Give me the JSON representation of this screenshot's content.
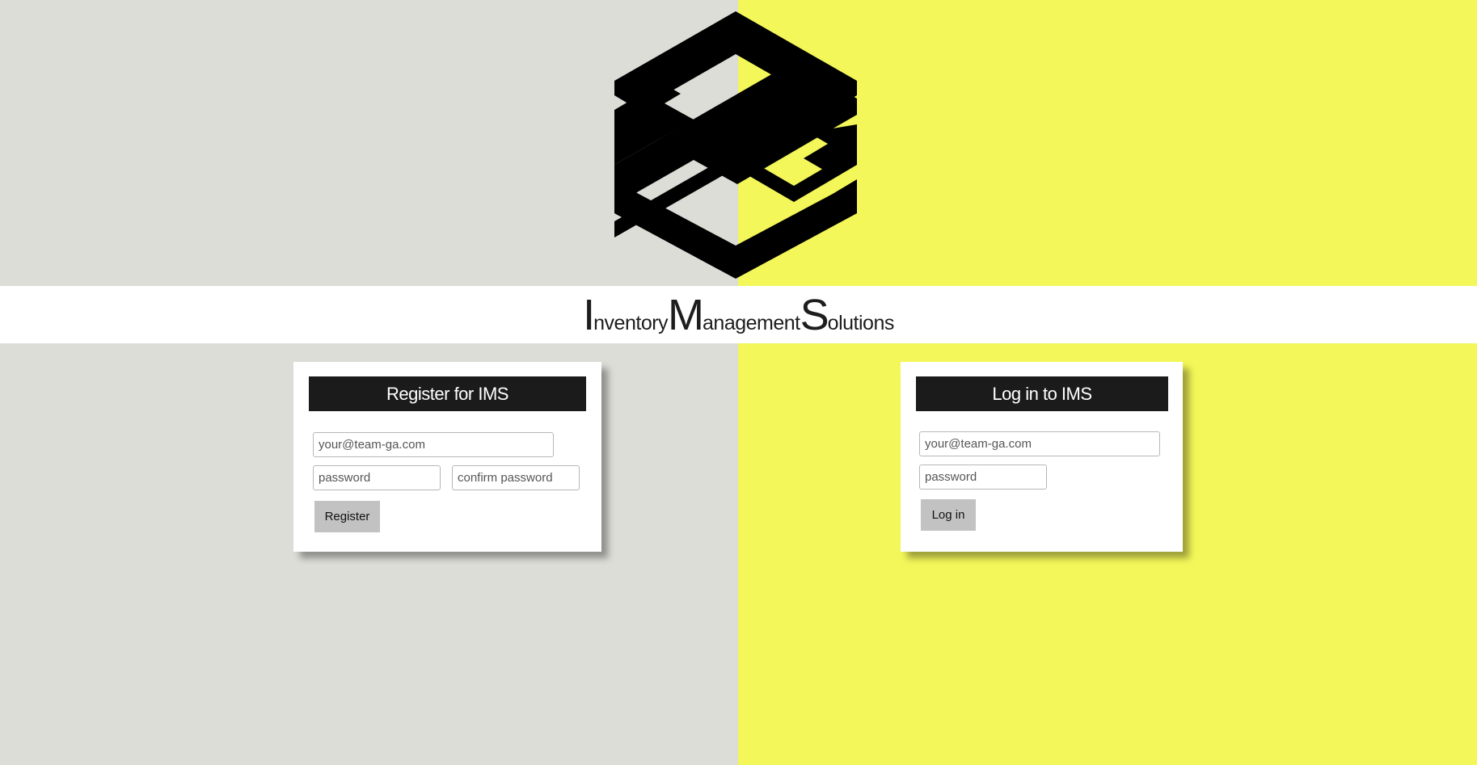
{
  "brand": {
    "logo_icon": "ims-hexagon-logo-icon",
    "title_parts": [
      "I",
      "nventory",
      "M",
      "anagement",
      "S",
      "olutions"
    ]
  },
  "register": {
    "title": "Register for IMS",
    "email_placeholder": "your@team-ga.com",
    "password_placeholder": "password",
    "confirm_placeholder": "confirm password",
    "button_label": "Register"
  },
  "login": {
    "title": "Log in to IMS",
    "email_placeholder": "your@team-ga.com",
    "password_placeholder": "password",
    "button_label": "Log in"
  },
  "colors": {
    "left_background": "#dcddd7",
    "right_background": "#f3f759",
    "header_background": "#1b1b1b",
    "button_background": "#c2c2c2"
  }
}
